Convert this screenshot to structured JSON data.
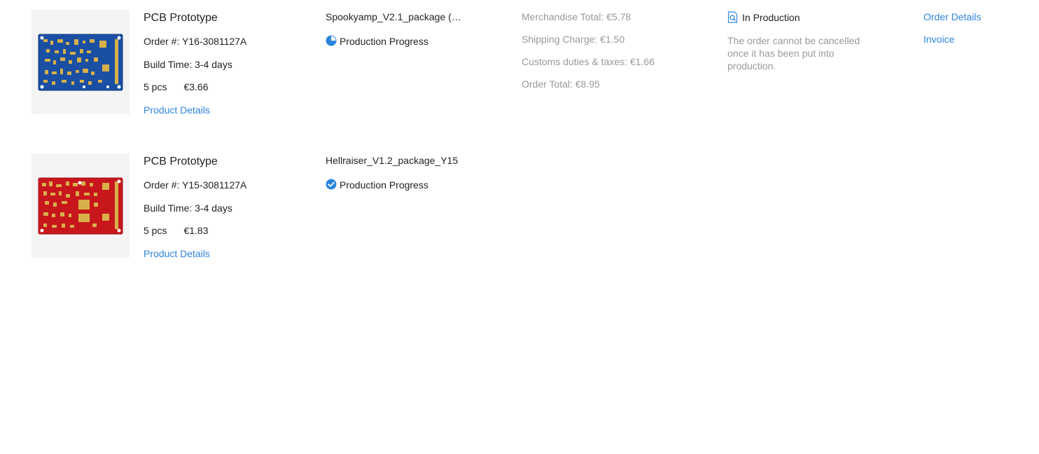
{
  "orders": [
    {
      "product_type": "PCB Prototype",
      "order_label": "Order #:",
      "order_number": "Y16-3081127A",
      "build_label": "Build Time:",
      "build_time": "3-4 days",
      "quantity": "5 pcs",
      "price": "€3.66",
      "product_details_label": "Product Details",
      "file_name": "Spookyamp_V2.1_package (…",
      "progress_label": "Production Progress",
      "progress_icon": "pie-progress-icon",
      "board_color": "#1a4fa3",
      "costs": {
        "merchandise": "Merchandise Total: €5.78",
        "shipping": "Shipping Charge: €1.50",
        "customs": "Customs duties & taxes: €1.66",
        "total": "Order Total: €8.95"
      },
      "status_icon": "document-search-icon",
      "status": "In Production",
      "status_note": "The order cannot be cancelled once it has been put into production.",
      "actions": {
        "order_details": "Order Details",
        "invoice": "Invoice"
      }
    },
    {
      "product_type": "PCB Prototype",
      "order_label": "Order #:",
      "order_number": "Y15-3081127A",
      "build_label": "Build Time:",
      "build_time": "3-4 days",
      "quantity": "5 pcs",
      "price": "€1.83",
      "product_details_label": "Product Details",
      "file_name": "Hellraiser_V1.2_package_Y15",
      "progress_label": "Production Progress",
      "progress_icon": "check-circle-icon",
      "board_color": "#c8161d"
    }
  ],
  "colors": {
    "link": "#2d85dc",
    "muted": "#999999",
    "accent": "#2d85dc"
  }
}
